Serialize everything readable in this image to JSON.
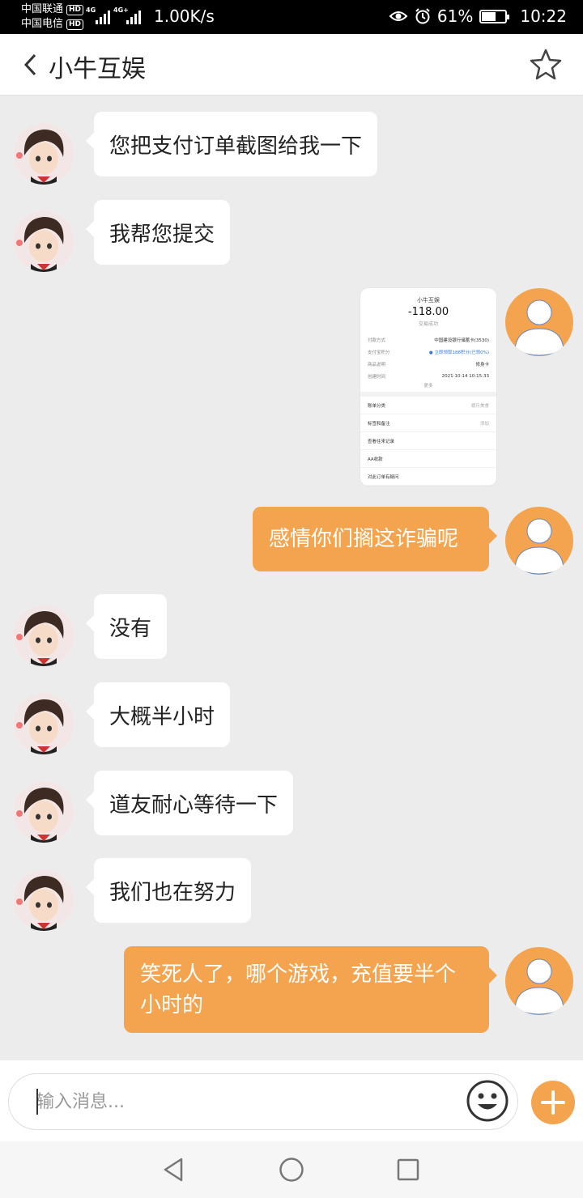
{
  "status_bar": {
    "carrier1": "中国联通",
    "carrier2": "中国电信",
    "hd_badge": "HD",
    "network1": "4G",
    "network2": "4G+",
    "net_speed": "1.00K/s",
    "battery_percent": "61%",
    "battery_level": 0.61,
    "time": "10:22",
    "icons": [
      "eye-icon",
      "alarm-icon",
      "battery-icon"
    ]
  },
  "header": {
    "back_icon": "chevron-left-icon",
    "title": "小牛互娱",
    "star_icon": "star-outline-icon"
  },
  "messages": [
    {
      "side": "left",
      "text": "您把支付订单截图给我一下"
    },
    {
      "side": "left",
      "text": "我帮您提交"
    },
    {
      "side": "right",
      "type": "image"
    },
    {
      "side": "right",
      "text": "感情你们搁这诈骗呢"
    },
    {
      "side": "left",
      "text": "没有"
    },
    {
      "side": "left",
      "text": "大概半小时"
    },
    {
      "side": "left",
      "text": "道友耐心等待一下"
    },
    {
      "side": "left",
      "text": "我们也在努力"
    },
    {
      "side": "right",
      "text": "笑死人了，哪个游戏，充值要半个小时的"
    }
  ],
  "screenshot_image": {
    "merchant": "小牛互娱",
    "amount": "-118.00",
    "state": "交易成功",
    "rows": [
      {
        "label": "付款方式",
        "value": "中国建设银行储蓄卡(3530)"
      },
      {
        "label": "支付宝积分",
        "value": "● 立即领取188积分(已领0%)"
      },
      {
        "label": "商品说明",
        "value": "修身卡"
      },
      {
        "label": "创建时间",
        "value": "2021-10-14 10:15:33"
      }
    ],
    "more": "更多",
    "links": [
      {
        "label": "账单分类",
        "value": "娱乐美食"
      },
      {
        "label": "标签和备注",
        "value": "添加"
      },
      {
        "label": "查看往来记录",
        "value": ""
      },
      {
        "label": "AA收款",
        "value": ""
      },
      {
        "label": "对此订单有疑问",
        "value": ""
      }
    ]
  },
  "input": {
    "placeholder": "输入消息...",
    "value": ""
  },
  "colors": {
    "accent": "#f4a44e",
    "background": "#ececec",
    "bubble_left": "#ffffff"
  }
}
